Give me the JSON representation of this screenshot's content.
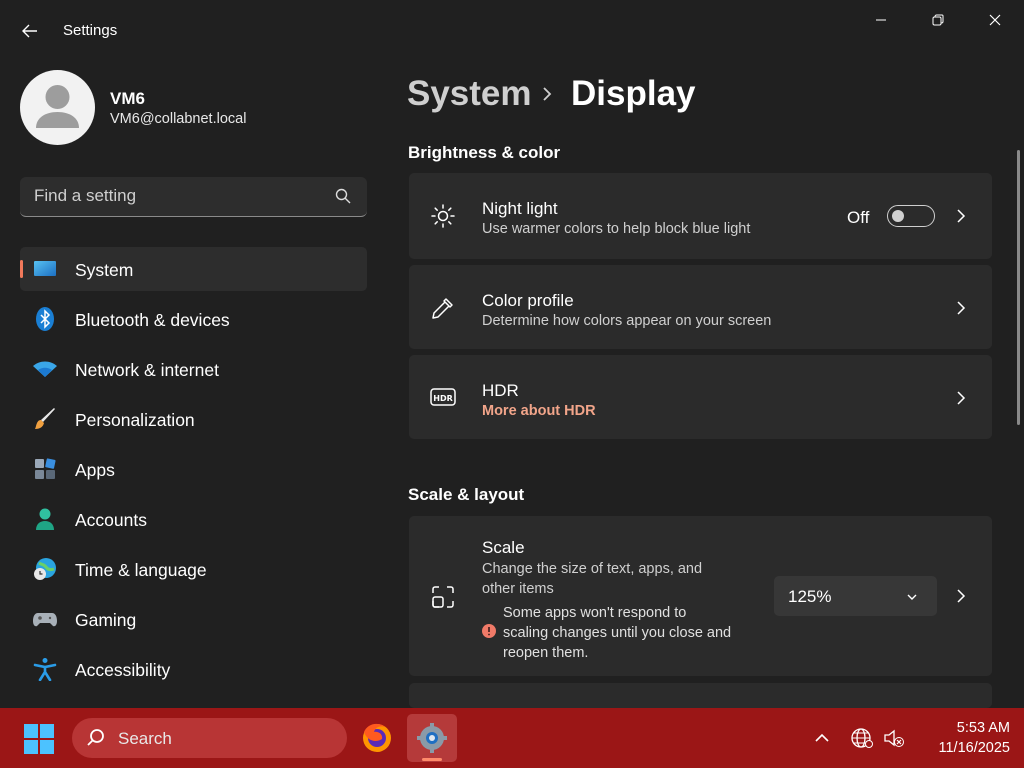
{
  "window": {
    "title": "Settings"
  },
  "user": {
    "name": "VM6",
    "email": "VM6@collabnet.local"
  },
  "search": {
    "placeholder": "Find a setting"
  },
  "nav": {
    "items": [
      {
        "label": "System",
        "icon": "system-icon",
        "selected": true
      },
      {
        "label": "Bluetooth & devices",
        "icon": "bluetooth-icon"
      },
      {
        "label": "Network & internet",
        "icon": "wifi-icon"
      },
      {
        "label": "Personalization",
        "icon": "brush-icon"
      },
      {
        "label": "Apps",
        "icon": "apps-icon"
      },
      {
        "label": "Accounts",
        "icon": "accounts-icon"
      },
      {
        "label": "Time & language",
        "icon": "globe-clock-icon"
      },
      {
        "label": "Gaming",
        "icon": "gamepad-icon"
      },
      {
        "label": "Accessibility",
        "icon": "accessibility-icon"
      }
    ]
  },
  "breadcrumb": {
    "parent": "System",
    "current": "Display"
  },
  "sections": {
    "brightness": {
      "title": "Brightness & color",
      "night_light": {
        "title": "Night light",
        "desc": "Use warmer colors to help block blue light",
        "state": "Off"
      },
      "color_profile": {
        "title": "Color profile",
        "desc": "Determine how colors appear on your screen"
      },
      "hdr": {
        "title": "HDR",
        "link": "More about HDR"
      }
    },
    "scale_layout": {
      "title": "Scale & layout",
      "scale": {
        "title": "Scale",
        "desc": "Change the size of text, apps, and other items",
        "warning": "Some apps won't respond to scaling changes until you close and reopen them.",
        "value": "125%"
      }
    }
  },
  "taskbar": {
    "search_label": "Search",
    "time": "5:53 AM",
    "date": "11/16/2025"
  },
  "colors": {
    "accent": "#f2795b",
    "taskbar": "#9b1616",
    "link": "#f2a58a"
  }
}
